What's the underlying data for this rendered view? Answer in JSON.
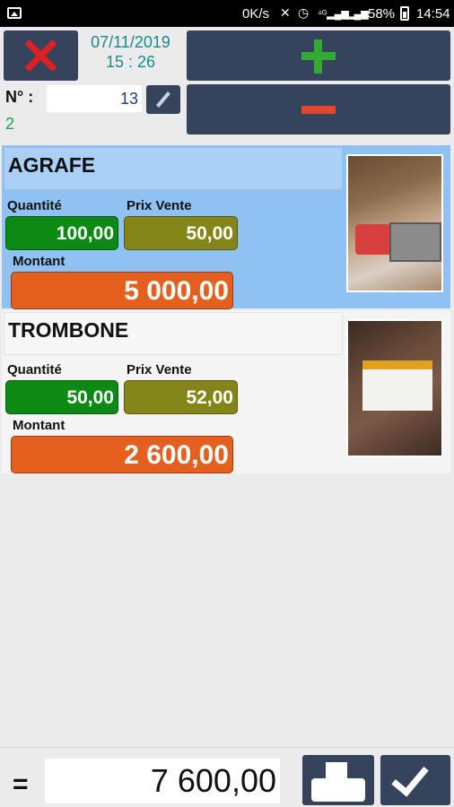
{
  "status_bar": {
    "network_speed": "0K/s",
    "battery_percent": "58%",
    "time": "14:54"
  },
  "header": {
    "date": "07/11/2019",
    "time": "15 : 26",
    "number_label": "N° :",
    "number_value": "13",
    "count": "2"
  },
  "items": [
    {
      "name": "AGRAFE",
      "quantity_label": "Quantité",
      "quantity": "100,00",
      "price_label": "Prix Vente",
      "price": "50,00",
      "amount_label": "Montant",
      "amount": "5 000,00",
      "selected": true
    },
    {
      "name": "TROMBONE",
      "quantity_label": "Quantité",
      "quantity": "50,00",
      "price_label": "Prix Vente",
      "price": "52,00",
      "amount_label": "Montant",
      "amount": "2 600,00",
      "selected": false
    }
  ],
  "footer": {
    "equals": "=",
    "total": "7 600,00"
  },
  "colors": {
    "button_bg": "#35445c",
    "quantity": "#0d8a14",
    "price": "#848518",
    "amount": "#e5601f",
    "selected_row": "#8fc1f2"
  }
}
